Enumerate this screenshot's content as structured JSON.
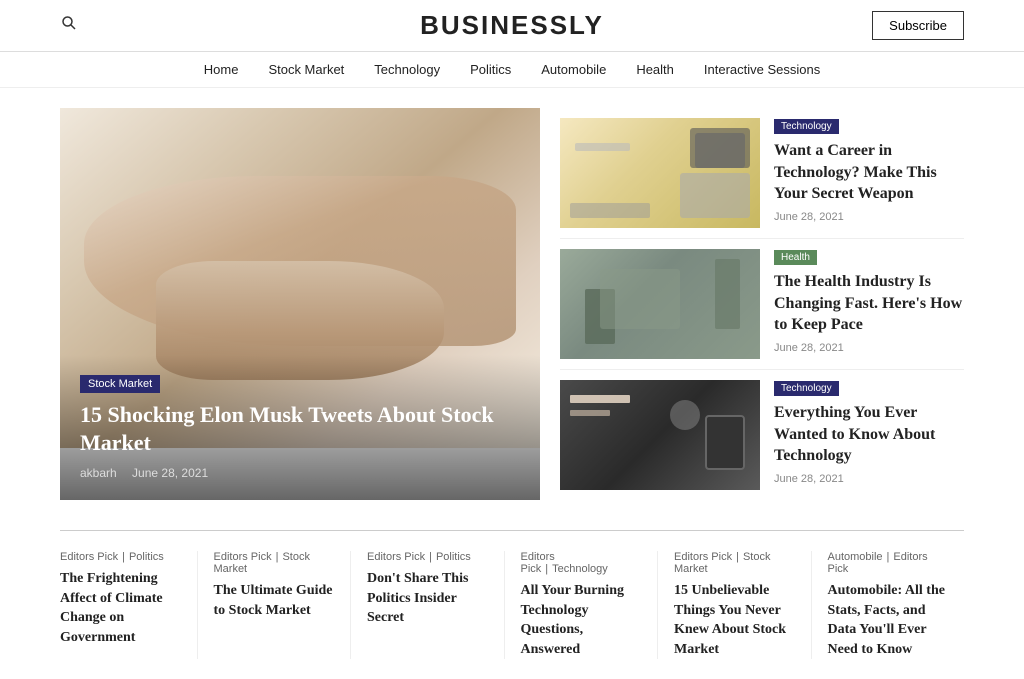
{
  "header": {
    "brand": "BUSINESSLY",
    "subscribe_label": "Subscribe"
  },
  "nav": {
    "items": [
      {
        "label": "Home",
        "href": "#"
      },
      {
        "label": "Stock Market",
        "href": "#"
      },
      {
        "label": "Technology",
        "href": "#"
      },
      {
        "label": "Politics",
        "href": "#"
      },
      {
        "label": "Automobile",
        "href": "#"
      },
      {
        "label": "Health",
        "href": "#"
      },
      {
        "label": "Interactive Sessions",
        "href": "#"
      }
    ]
  },
  "featured": {
    "category": "Stock Market",
    "title": "15 Shocking Elon Musk Tweets About Stock Market",
    "author": "akbarh",
    "date": "June 28, 2021"
  },
  "side_articles": [
    {
      "category": "Technology",
      "category_type": "tech",
      "title": "Want a Career in Technology? Make This Your Secret Weapon",
      "date": "June 28, 2021"
    },
    {
      "category": "Health",
      "category_type": "health",
      "title": "The Health Industry Is Changing Fast. Here's How to Keep Pace",
      "date": "June 28, 2021"
    },
    {
      "category": "Technology",
      "category_type": "tech",
      "title": "Everything You Ever Wanted to Know About Technology",
      "date": "June 28, 2021"
    }
  ],
  "bottom_cards": [
    {
      "cat1": "Editors Pick",
      "cat2": "Politics",
      "title": "The Frightening Affect of Climate Change on Government"
    },
    {
      "cat1": "Editors Pick",
      "cat2": "Stock Market",
      "title": "The Ultimate Guide to Stock Market"
    },
    {
      "cat1": "Editors Pick",
      "cat2": "Politics",
      "title": "Don't Share This Politics Insider Secret"
    },
    {
      "cat1": "Editors Pick",
      "cat2": "Technology",
      "title": "All Your Burning Technology Questions, Answered"
    },
    {
      "cat1": "Editors Pick",
      "cat2": "Stock Market",
      "title": "15 Unbelievable Things You Never Knew About Stock Market"
    },
    {
      "cat1": "Automobile",
      "cat2": "Editors Pick",
      "title": "Automobile: All the Stats, Facts, and Data You'll Ever Need to Know"
    }
  ]
}
